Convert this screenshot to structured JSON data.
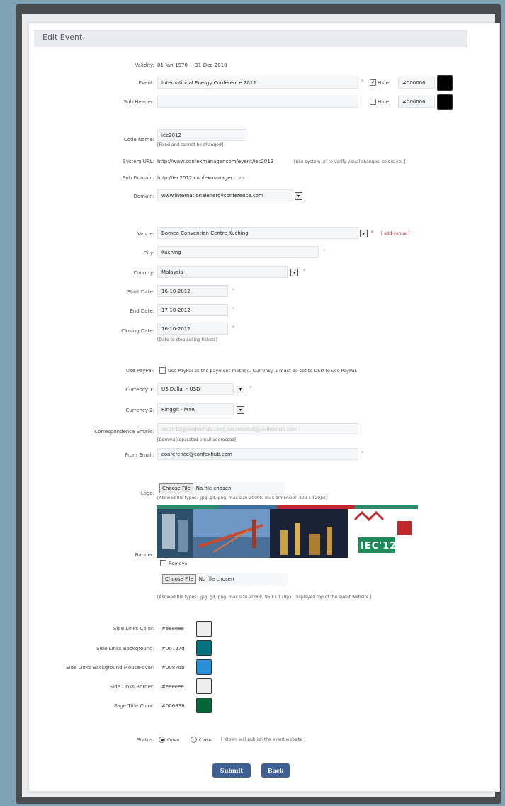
{
  "title": "Edit Event",
  "validity": {
    "label": "Validity:",
    "value": "01-Jan-1970 ~ 31-Dec-2018"
  },
  "event": {
    "label": "Event:",
    "value": "International Energy Conference 2012",
    "hide_label": "Hide",
    "hide_checked": true,
    "color": "#000000",
    "swatch": "#000000"
  },
  "sub_header": {
    "label": "Sub Header:",
    "value": "",
    "hide_label": "Hide",
    "hide_checked": false,
    "color": "#000000",
    "swatch": "#000000"
  },
  "code_name": {
    "label": "Code Name:",
    "value": "iec2012",
    "note": "[Fixed and cannot be changed]"
  },
  "system_url": {
    "label": "System URL:",
    "value": "http://www.confexmanager.com/event/iec2012",
    "note": "[Use system url to verify visual changes, colors etc.]"
  },
  "sub_domain": {
    "label": "Sub Domain:",
    "value": "http://iec2012.confexmanager.com"
  },
  "domain": {
    "label": "Domain:",
    "value": "www.internationalenergyconference.com"
  },
  "venue": {
    "label": "Venue:",
    "value": "Borneo Convention Centre Kuching",
    "add_link": "[ add venue ]"
  },
  "city": {
    "label": "City:",
    "value": "Kuching"
  },
  "country": {
    "label": "Country:",
    "value": "Malaysia"
  },
  "start_date": {
    "label": "Start Date:",
    "value": "16-10-2012"
  },
  "end_date": {
    "label": "End Date:",
    "value": "17-10-2012"
  },
  "closing_date": {
    "label": "Closing Date:",
    "value": "16-10-2012",
    "note": "[Date to stop selling tickets]"
  },
  "paypal": {
    "label": "Use PayPal:",
    "text": "Use PayPal as the payment method. Currency 1 must be set to USD to use PayPal.",
    "checked": false
  },
  "currency1": {
    "label": "Currency 1:",
    "value": "US Dollar - USD"
  },
  "currency2": {
    "label": "Currency 2:",
    "value": "Ringgit - MYR"
  },
  "correspondence": {
    "label": "Correspondence Emails:",
    "value": "iec2012@confexhub.com, secretariat@confexhub.com",
    "note": "[Comma separated email addresses]"
  },
  "from_email": {
    "label": "From Email:",
    "value": "conference@confexhub.com"
  },
  "logo": {
    "label": "Logo:",
    "button": "Choose File",
    "status": "No file chosen",
    "note": "[Allowed file types: .jpg,.gif,.png. max size 2000k, max dimension 300 x 120px]"
  },
  "banner": {
    "label": "Banner:",
    "remove_label": "Remove",
    "button": "Choose File",
    "status": "No file chosen",
    "note": "[Allowed file types: .jpg,.gif,.png. max size 2000k, 950 x 170px. Displayed top of the event website.]",
    "logo_text": "IEC'12"
  },
  "colors": [
    {
      "label": "Side Links Color:",
      "value": "#eeeeee",
      "swatch": "#eeeeee"
    },
    {
      "label": "Side Links Background:",
      "value": "#00727d",
      "swatch": "#00727d"
    },
    {
      "label": "Side Links Background Mouse-over:",
      "value": "#0087db",
      "swatch": "#2a8fd6"
    },
    {
      "label": "Side Links Border:",
      "value": "#eeeeee",
      "swatch": "#eeeeee"
    },
    {
      "label": "Page Title Color:",
      "value": "#006838",
      "swatch": "#006838"
    }
  ],
  "status": {
    "label": "Status:",
    "open": "Open",
    "close": "Close",
    "selected": "open",
    "note": "[ 'Open' will publish the event website ]"
  },
  "buttons": {
    "submit": "Submit",
    "back": "Back"
  }
}
